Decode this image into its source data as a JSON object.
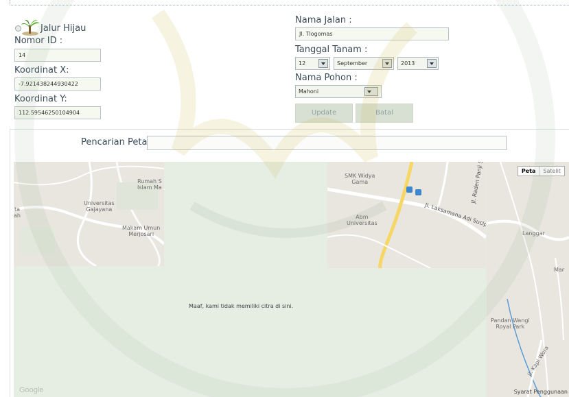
{
  "form": {
    "layer_label": "Jalur Hijau",
    "id_label": "Nomor ID :",
    "id_value": "14",
    "x_label": "Koordinat X:",
    "x_value": "-7.921438244930422",
    "y_label": "Koordinat Y:",
    "y_value": "112.59546250104904",
    "street_label": "Nama Jalan :",
    "street_value": "Jl. Tlogomas",
    "date_label": "Tanggal Tanam :",
    "day": "12",
    "month": "September",
    "year": "2013",
    "tree_label": "Nama Pohon :",
    "tree_value": "Mahoni",
    "update_label": "Update",
    "cancel_label": "Batal"
  },
  "search": {
    "label": "Pencarian Peta :",
    "value": ""
  },
  "map": {
    "no_imagery_message": "Maaf, kami tidak memiliki citra di sini.",
    "map_type_peta": "Peta",
    "map_type_satelit": "Satelit",
    "provider": "Google",
    "terms": "Syarat Penggunaan",
    "places": {
      "rumah_sakit": "Rumah S\nIslam Ma",
      "universitas": "Universitas\nGajayana",
      "makam": "Makam Umun\nMerjosari",
      "smk": "SMK Widya\nGama",
      "abm": "Abm\nUniversitas",
      "jalan_laksamana": "Jl. Laksamana Adi Sucipto",
      "jalan_raden": "Jl. Raden Panji Su",
      "langgar": "Langgar",
      "pandan_wangi": "Pandan Wangi\nRoyal Park",
      "mar": "Mar",
      "jalan_kapi": "Jl. Kapi Wora",
      "ta": "ta\nah"
    }
  }
}
